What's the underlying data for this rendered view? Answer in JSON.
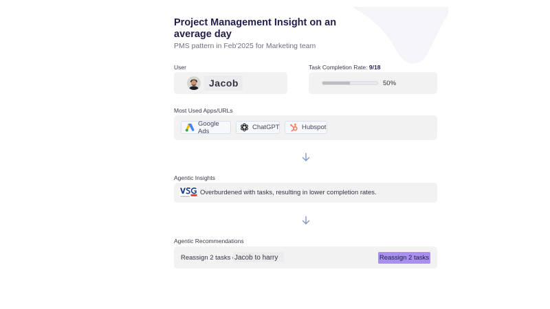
{
  "header": {
    "title": "Project Management Insight on an average day",
    "subtitle": "PMS pattern in Feb'2025 for Marketing team"
  },
  "user": {
    "label": "User",
    "name": "Jacob",
    "avatar_icon": "user-avatar-photo"
  },
  "task_completion": {
    "label": "Task Completion Rate:",
    "value": "9/18",
    "percent_text": "50%",
    "progress": 0.5,
    "fill_color": "#bdbdbf"
  },
  "apps": {
    "label": "Most Used Apps/URLs",
    "items": [
      {
        "name": "Google Ads",
        "icon": "google-ads-icon"
      },
      {
        "name": "ChatGPT",
        "icon": "chatgpt-icon"
      },
      {
        "name": "Hubspot",
        "icon": "hubspot-icon"
      }
    ]
  },
  "insights": {
    "label": "Agentic Insights",
    "logo_icon": "vsg-logo",
    "text": "Overburdened with tasks, resulting in lower completion rates."
  },
  "recommendations": {
    "label": "Agentic Recommendations",
    "text_prefix": "Reassign 2 tasks of",
    "text_names": "Jacob to harry",
    "button_label": "Reassign 2 tasks",
    "button_color": "#a98ff0"
  },
  "colors": {
    "title": "#1f1e4d",
    "arrow": "#7d95cc",
    "panel_bg": "#f2f2f3"
  }
}
